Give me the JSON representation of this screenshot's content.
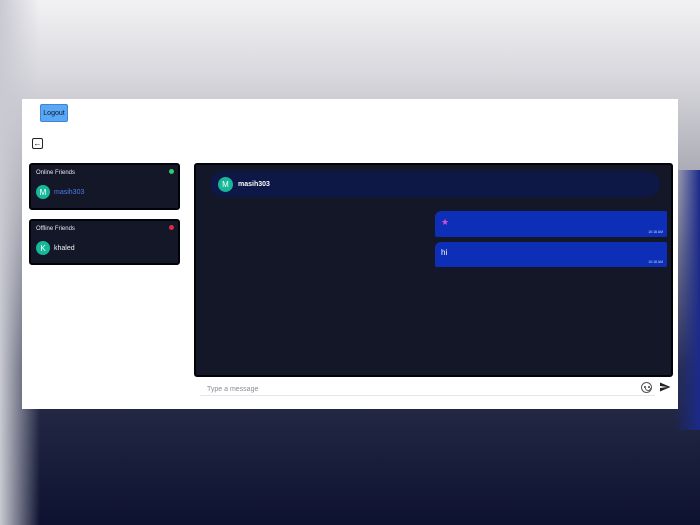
{
  "header": {
    "logout_label": "Logout",
    "back_icon": "arrow-left-icon"
  },
  "online_friends": {
    "title": "Online Friends",
    "status_color": "#2ecc71",
    "items": [
      {
        "initial": "M",
        "name": "masih303"
      }
    ]
  },
  "offline_friends": {
    "title": "Offline Friends",
    "status_color": "#e0294a",
    "items": [
      {
        "initial": "K",
        "name": "khaled"
      }
    ]
  },
  "chat": {
    "contact": {
      "initial": "M",
      "name": "masih303"
    },
    "messages": [
      {
        "text": "★",
        "time": "10:18 AM"
      },
      {
        "text": "hi",
        "time": "10:18 AM"
      }
    ]
  },
  "composer": {
    "placeholder": "Type a message",
    "emoji_icon": "smiley-icon",
    "send_icon": "send-icon"
  },
  "colors": {
    "accent": "#5aa8f5",
    "panel_bg": "#131727",
    "bubble": "#0d2fb8",
    "avatar": "#17b897"
  }
}
